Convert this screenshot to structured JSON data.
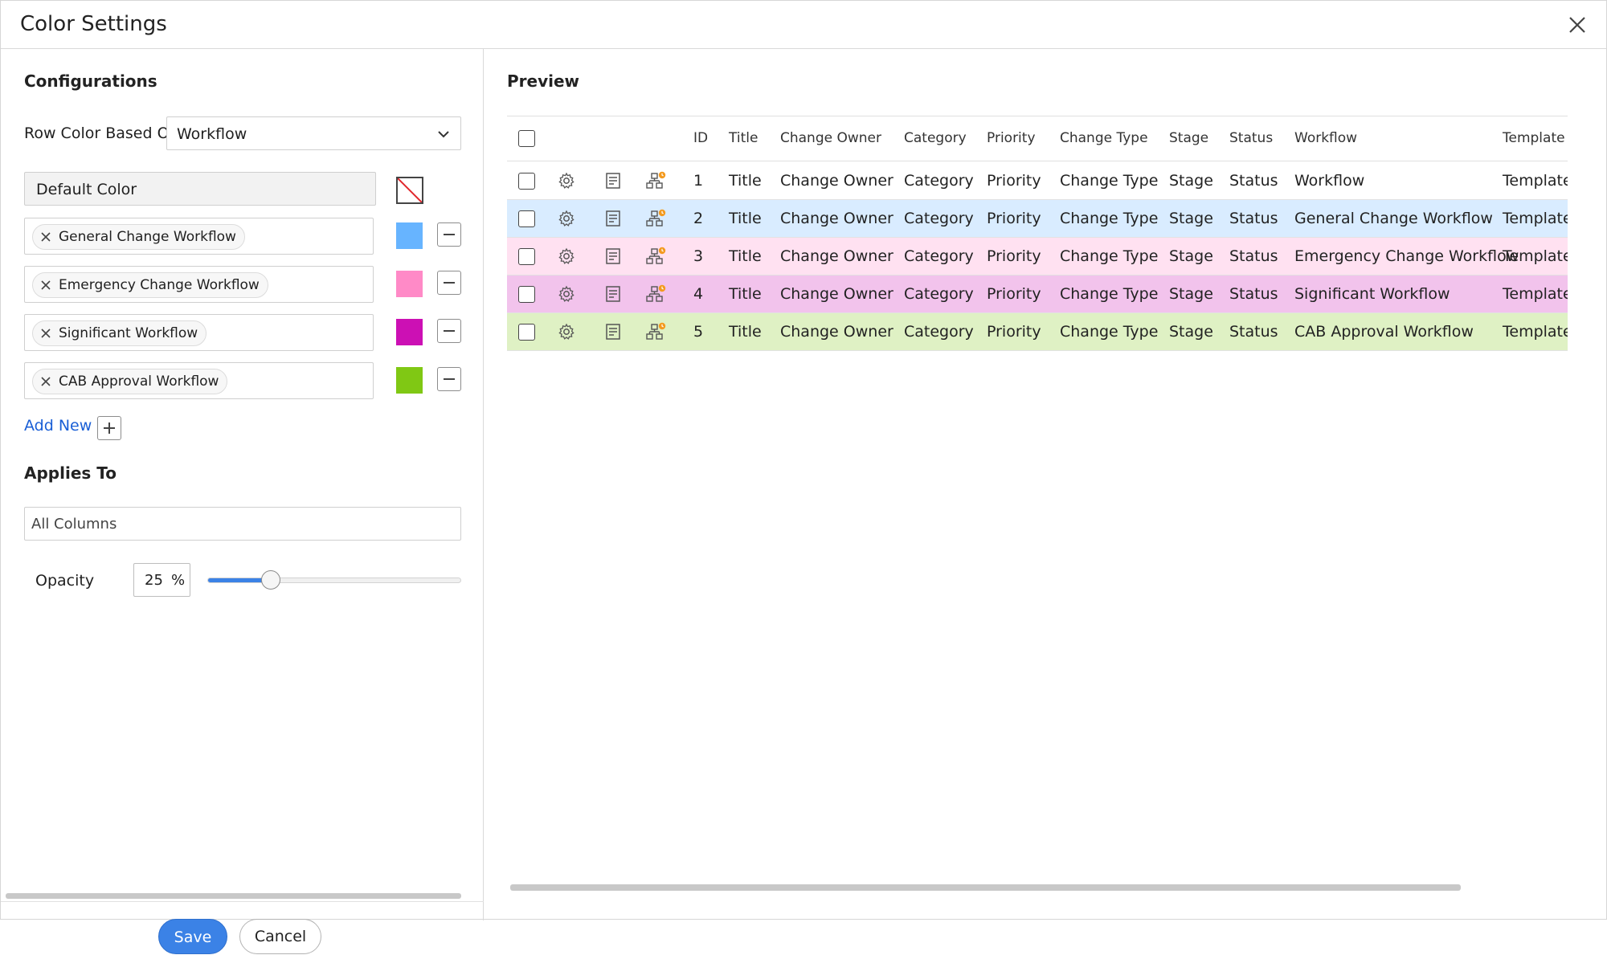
{
  "window": {
    "title": "Color Settings"
  },
  "left": {
    "configurations_title": "Configurations",
    "row_color_label": "Row Color Based On",
    "row_color_value": "Workflow",
    "default_color_label": "Default Color",
    "workflows": [
      {
        "label": "General Change Workflow",
        "color": "#67b4ff"
      },
      {
        "label": "Emergency Change Workflow",
        "color": "#ff8ac7"
      },
      {
        "label": "Significant Workflow",
        "color": "#cc10b4"
      },
      {
        "label": "CAB Approval Workflow",
        "color": "#80c814"
      }
    ],
    "add_new_label": "Add New",
    "applies_to_title": "Applies To",
    "applies_to_value": "All Columns",
    "opacity_label": "Opacity",
    "opacity_value": "25",
    "opacity_unit": "%",
    "opacity_fraction": 0.25,
    "save_label": "Save",
    "cancel_label": "Cancel"
  },
  "preview": {
    "title": "Preview",
    "columns": [
      "ID",
      "Title",
      "Change Owner",
      "Category",
      "Priority",
      "Change Type",
      "Stage",
      "Status",
      "Workflow",
      "Template"
    ],
    "rows": [
      {
        "id": "1",
        "title": "Title",
        "owner": "Change Owner",
        "category": "Category",
        "priority": "Priority",
        "type": "Change Type",
        "stage": "Stage",
        "status": "Status",
        "workflow": "Workflow",
        "template": "Template",
        "bg": "#ffffff"
      },
      {
        "id": "2",
        "title": "Title",
        "owner": "Change Owner",
        "category": "Category",
        "priority": "Priority",
        "type": "Change Type",
        "stage": "Stage",
        "status": "Status",
        "workflow": "General Change Workflow",
        "template": "Template",
        "bg": "#d9ecff"
      },
      {
        "id": "3",
        "title": "Title",
        "owner": "Change Owner",
        "category": "Category",
        "priority": "Priority",
        "type": "Change Type",
        "stage": "Stage",
        "status": "Status",
        "workflow": "Emergency Change Workflow",
        "template": "Template",
        "bg": "#ffe1f1"
      },
      {
        "id": "4",
        "title": "Title",
        "owner": "Change Owner",
        "category": "Category",
        "priority": "Priority",
        "type": "Change Type",
        "stage": "Stage",
        "status": "Status",
        "workflow": "Significant Workflow",
        "template": "Template",
        "bg": "#f2c3ec"
      },
      {
        "id": "5",
        "title": "Title",
        "owner": "Change Owner",
        "category": "Category",
        "priority": "Priority",
        "type": "Change Type",
        "stage": "Stage",
        "status": "Status",
        "workflow": "CAB Approval Workflow",
        "template": "Template",
        "bg": "#dff1c4"
      }
    ]
  }
}
